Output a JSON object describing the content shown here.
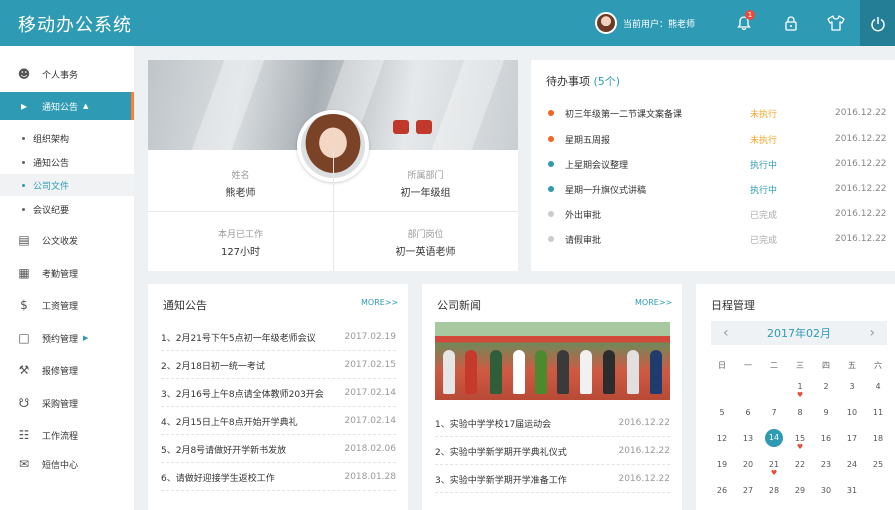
{
  "header": {
    "title": "移动办公系统",
    "user_label": "当前用户：熊老师",
    "notification_count": "1"
  },
  "sidebar": {
    "items": [
      {
        "label": "个人事务",
        "icon": "user-icon"
      },
      {
        "label": "通知公告",
        "icon": "megaphone-icon",
        "active": true
      },
      {
        "label": "公文收发",
        "icon": "document-icon"
      },
      {
        "label": "考勤管理",
        "icon": "calendar-check-icon"
      },
      {
        "label": "工资管理",
        "icon": "money-bag-icon"
      },
      {
        "label": "预约管理",
        "icon": "clipboard-icon"
      },
      {
        "label": "报修管理",
        "icon": "tools-icon"
      },
      {
        "label": "采购管理",
        "icon": "cart-icon"
      },
      {
        "label": "工作流程",
        "icon": "flow-icon"
      },
      {
        "label": "短信中心",
        "icon": "mail-icon"
      }
    ],
    "sub_items": [
      "组织架构",
      "通知公告",
      "公司文件",
      "会议纪要"
    ],
    "caret_up": "▲",
    "caret_right": "▶"
  },
  "profile": {
    "name_label": "姓名",
    "name": "熊老师",
    "dept_label": "所属部门",
    "dept": "初一年级组",
    "hours_label": "本月已工作",
    "hours": "127小时",
    "position_label": "部门岗位",
    "position": "初一英语老师"
  },
  "todo": {
    "title": "待办事项",
    "count": "(5个)",
    "items": [
      {
        "title": "初三年级第一二节课文案备课",
        "status": "未执行",
        "date": "2016.12.22",
        "dot_color": "#f26522",
        "status_color": "#f5a623"
      },
      {
        "title": "星期五周报",
        "status": "未执行",
        "date": "2016.12.22",
        "dot_color": "#f26522",
        "status_color": "#f5a623"
      },
      {
        "title": "上星期会议整理",
        "status": "执行中",
        "date": "2016.12.22",
        "dot_color": "#2f9ab4",
        "status_color": "#2f9ab4"
      },
      {
        "title": "星期一升旗仪式讲稿",
        "status": "执行中",
        "date": "2016.12.22",
        "dot_color": "#2f9ab4",
        "status_color": "#2f9ab4"
      },
      {
        "title": "外出审批",
        "status": "已完成",
        "date": "2016.12.22",
        "dot_color": "#cccccc",
        "status_color": "#aaaaaa"
      },
      {
        "title": "请假审批",
        "status": "已完成",
        "date": "2016.12.22",
        "dot_color": "#cccccc",
        "status_color": "#aaaaaa"
      }
    ]
  },
  "notices": {
    "title": "通知公告",
    "more": "MORE>>",
    "items": [
      {
        "text": "1、2月21号下午5点初一年级老师会议",
        "date": "2017.02.19"
      },
      {
        "text": "2、2月18日初一统一考试",
        "date": "2017.02.15"
      },
      {
        "text": "3、2月16号上午8点请全体教师203开会",
        "date": "2017.02.14"
      },
      {
        "text": "4、2月15日上午8点开始开学典礼",
        "date": "2017.02.14"
      },
      {
        "text": "5、2月8号请做好开学新书发放",
        "date": "2018.02.06"
      },
      {
        "text": "6、请做好迎接学生返校工作",
        "date": "2018.01.28"
      }
    ]
  },
  "news": {
    "title": "公司新闻",
    "more": "MORE>>",
    "items": [
      {
        "text": "1、实验中学学校17届运动会",
        "date": "2016.12.22"
      },
      {
        "text": "2、实验中学新学期开学典礼仪式",
        "date": "2016.12.22"
      },
      {
        "text": "3、实验中学新学期开学准备工作",
        "date": "2016.12.22"
      }
    ]
  },
  "calendar": {
    "title": "日程管理",
    "month": "2017年02月",
    "prev": "‹",
    "next": "›",
    "weekdays": [
      "日",
      "一",
      "二",
      "三",
      "四",
      "五",
      "六"
    ],
    "first_weekday": 3,
    "days": 31,
    "today": 14,
    "marked": [
      1,
      15,
      21
    ]
  }
}
